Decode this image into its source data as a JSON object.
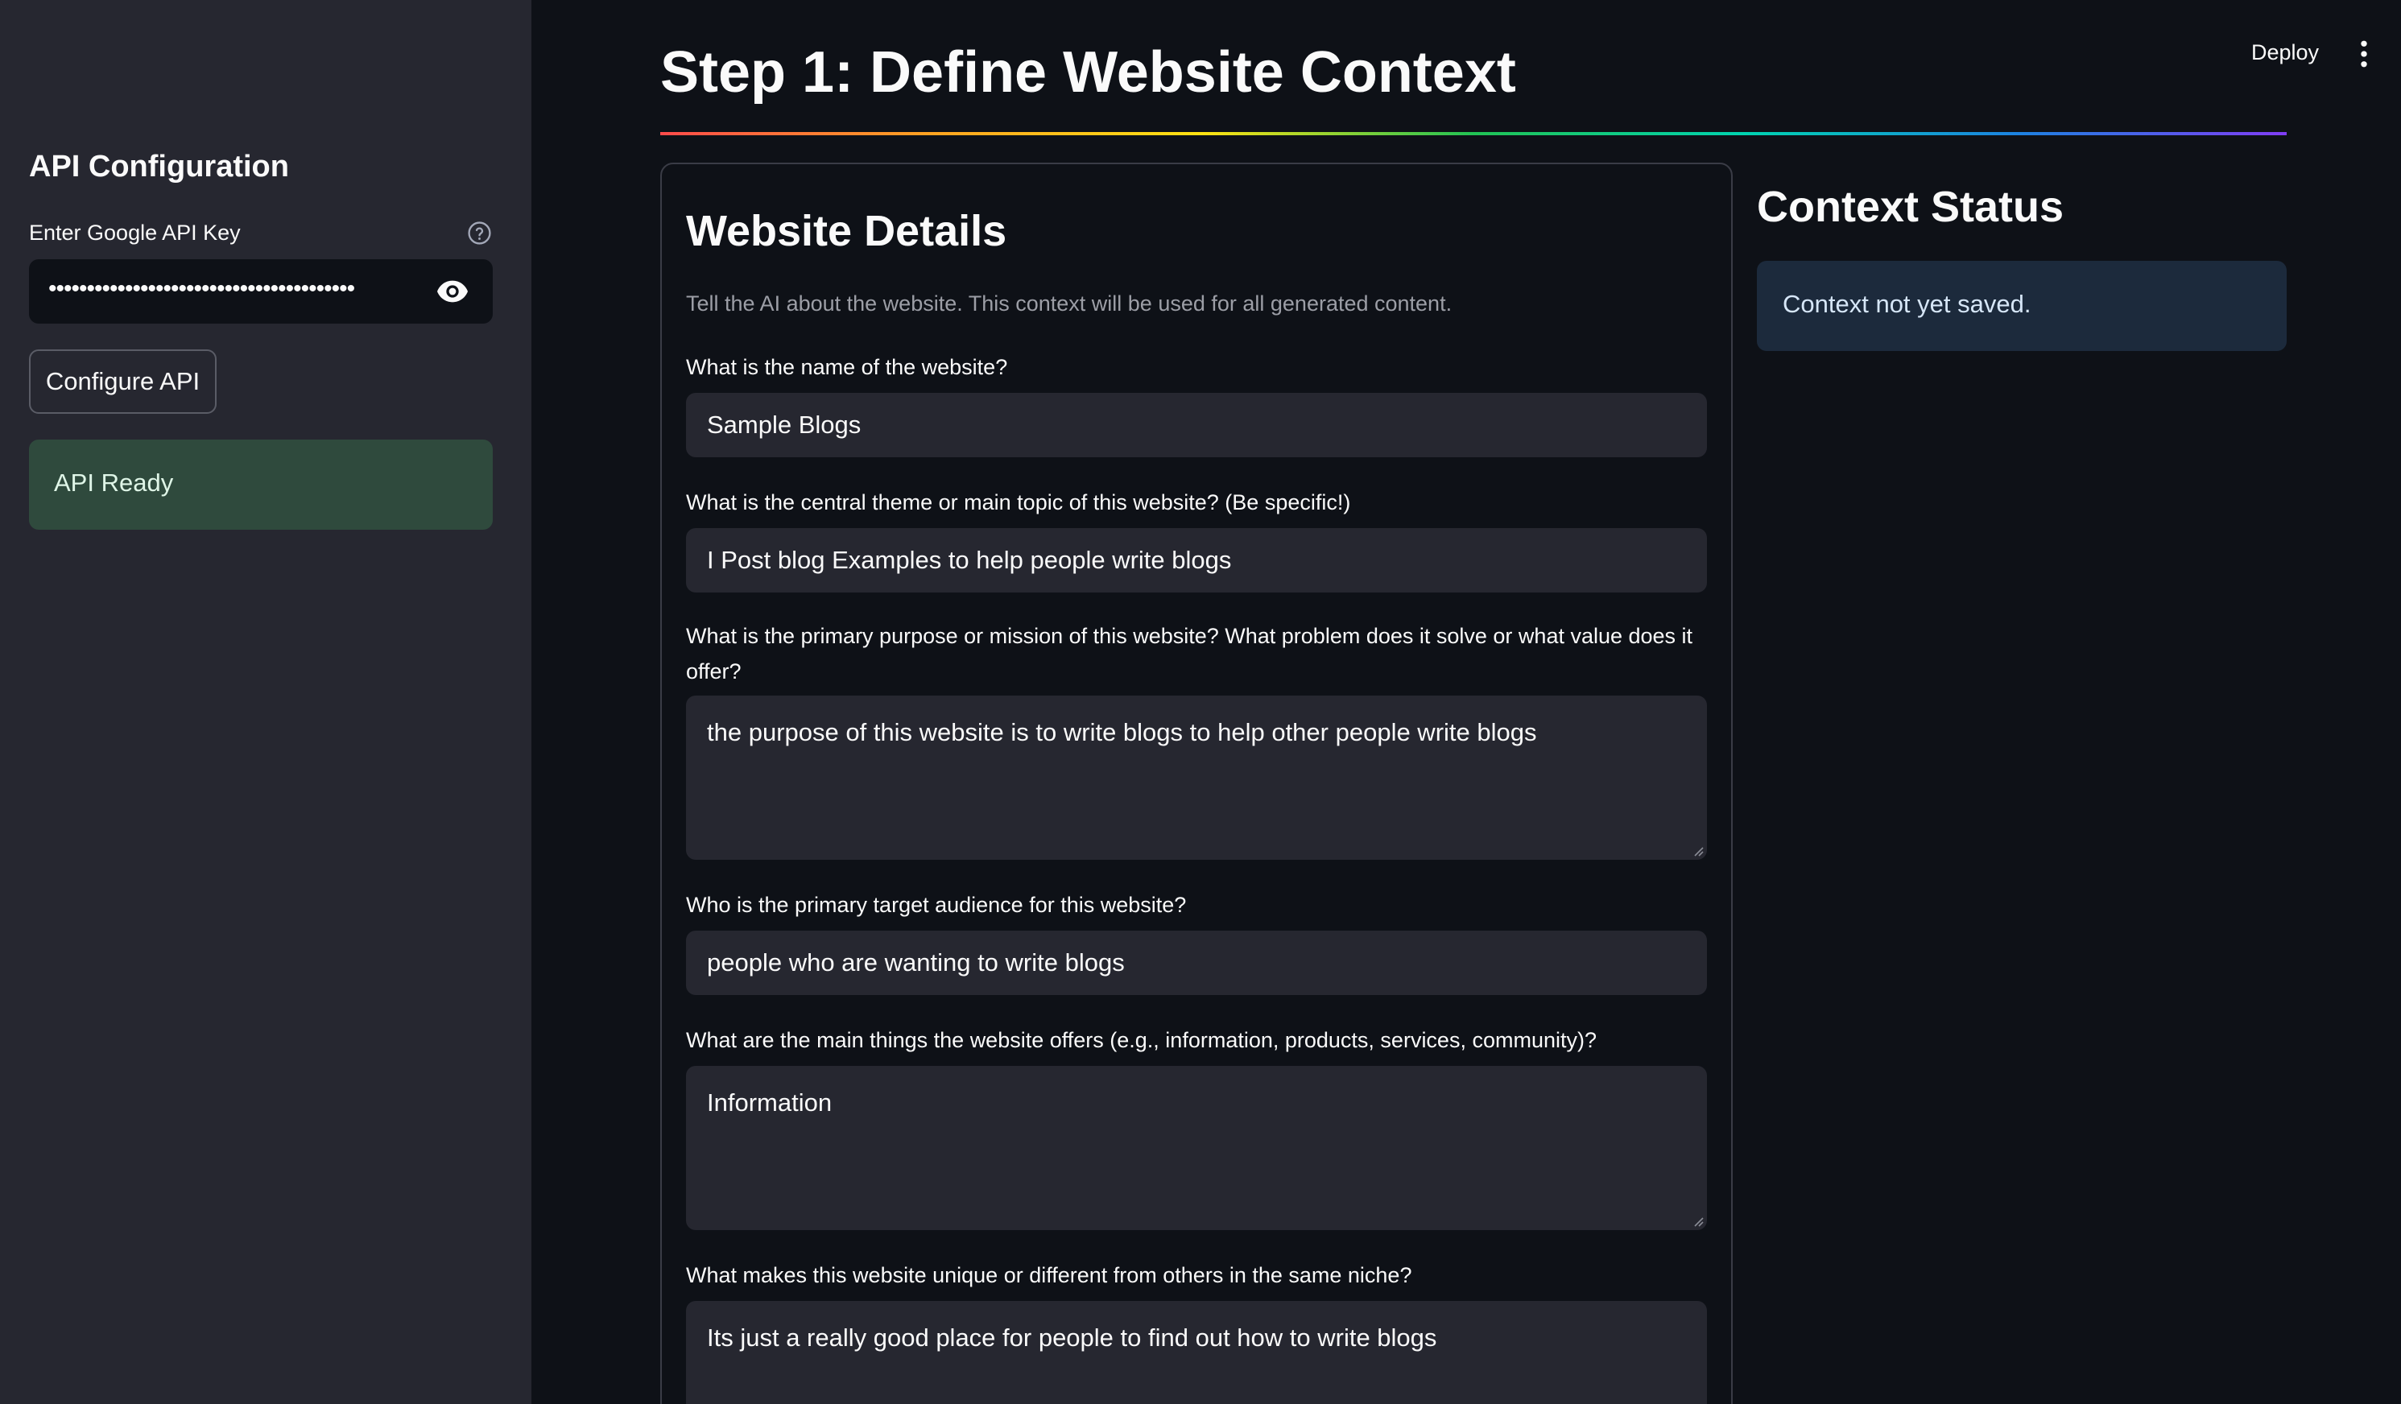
{
  "sidebar": {
    "title": "API Configuration",
    "api_key_label": "Enter Google API Key",
    "api_key_value": "••••••••••••••••••••••••••••••••••••••••",
    "configure_button": "Configure API",
    "status": "API Ready"
  },
  "header": {
    "deploy_label": "Deploy"
  },
  "main": {
    "step_heading": "Step 1: Define Website Context",
    "form": {
      "title": "Website Details",
      "caption": "Tell the AI about the website. This context will be used for all generated content.",
      "questions": [
        {
          "label": "What is the name of the website?",
          "value": "Sample Blogs"
        },
        {
          "label": "What is the central theme or main topic of this website? (Be specific!)",
          "value": "I Post blog Examples to help people write blogs"
        },
        {
          "label": "What is the primary purpose or mission of this website? What problem does it solve or what value does it offer?",
          "value": "the purpose of this website is to write blogs to help other people write blogs"
        },
        {
          "label": "Who is the primary target audience for this website?",
          "value": "people who are wanting to write blogs"
        },
        {
          "label": "What are the main things the website offers (e.g., information, products, services, community)?",
          "value": "Information"
        },
        {
          "label": "What makes this website unique or different from others in the same niche?",
          "value": "Its just a really good place for people to find out how to write blogs"
        }
      ]
    },
    "context_status": {
      "title": "Context Status",
      "message": "Context not yet saved."
    }
  }
}
